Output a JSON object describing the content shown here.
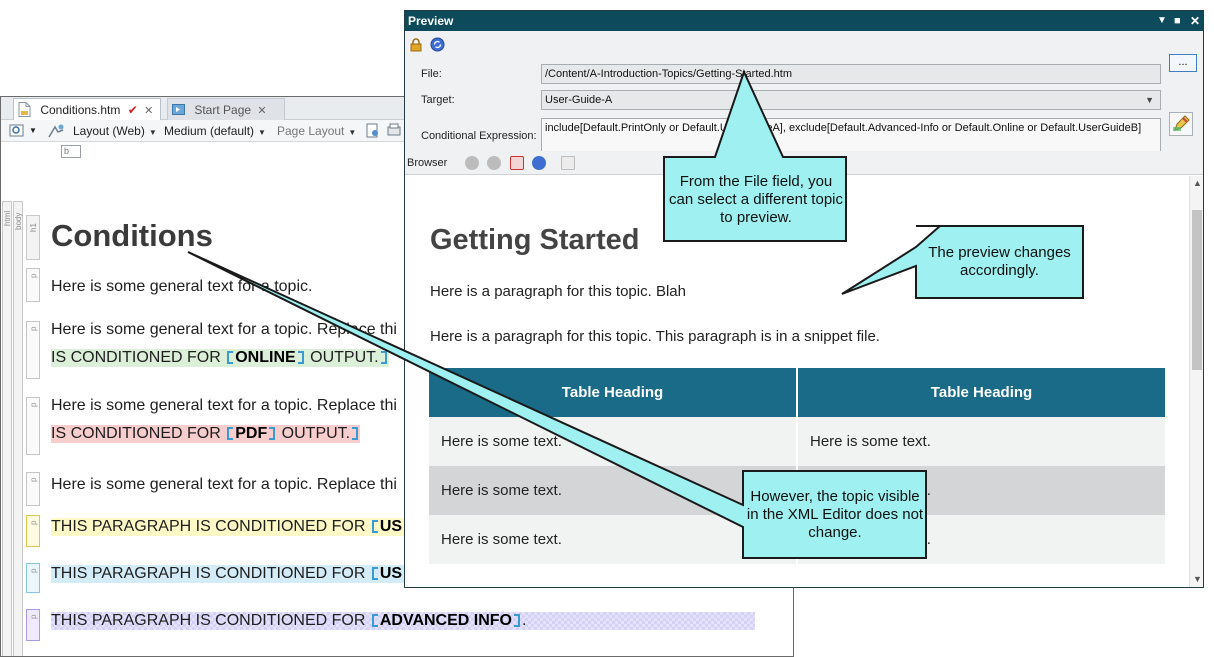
{
  "editor": {
    "tabs": [
      {
        "label": "Conditions.htm",
        "modified": "✔",
        "close": "✕"
      },
      {
        "label": "Start Page",
        "close": "✕"
      }
    ],
    "toolbar": {
      "layout": "Layout (Web)",
      "medium": "Medium (default)",
      "page_layout": "Page Layout"
    },
    "chip": "b",
    "structure_labels": [
      "html",
      "body",
      "h1"
    ],
    "p_label": "p",
    "heading": "Conditions",
    "paragraphs": [
      {
        "text": "Here is some general text for a topic."
      },
      {
        "line1": "Here is some general text for a topic. Replace thi",
        "prefix": "IS CONDITIONED FOR ",
        "keyword": "ONLINE",
        "suffix": " OUTPUT."
      },
      {
        "line1": "Here is some general text for a topic. Replace thi",
        "prefix": "IS CONDITIONED FOR ",
        "keyword": "PDF",
        "suffix": " OUTPUT."
      },
      {
        "text": "Here is some general text for a topic. Replace thi"
      },
      {
        "prefix": "THIS PARAGRAPH IS CONDITIONED FOR ",
        "keyword": "US"
      },
      {
        "prefix": "THIS PARAGRAPH IS CONDITIONED FOR ",
        "keyword": "US"
      },
      {
        "prefix": "THIS PARAGRAPH IS CONDITIONED FOR ",
        "keyword": "ADVANCED INFO",
        "suffix": "."
      }
    ]
  },
  "preview": {
    "title": "Preview",
    "file_label": "File:",
    "file_value": "/Content/A-Introduction-Topics/Getting-Started.htm",
    "browse_label": "...",
    "target_label": "Target:",
    "target_value": "User-Guide-A",
    "cond_label": "Conditional Expression:",
    "cond_value": "include[Default.PrintOnly or Default.UserGuideA], exclude[Default.Advanced-Info or Default.Online or Default.UserGuideB]",
    "browser_label": "Browser",
    "page": {
      "heading": "Getting Started",
      "p1": "Here is a paragraph for this topic. Blah",
      "p2": "Here is a paragraph for this topic. This paragraph is in a snippet file.",
      "table_headers": [
        "Table Heading",
        "Table Heading"
      ],
      "table_rows": [
        [
          "Here is some text.",
          "Here is some text."
        ],
        [
          "Here is some text.",
          "Here is some text."
        ],
        [
          "Here is some text.",
          "Here is some text."
        ]
      ]
    }
  },
  "callouts": {
    "file": "From the File field, you can select a different topic to preview.",
    "preview": "The preview changes accordingly.",
    "editor": "However, the topic visible in the XML Editor does not change."
  },
  "colors": {
    "callout_fill": "#9ff0f0",
    "callout_stroke": "#1a1a1a",
    "preview_title": "#0d4b5c",
    "table_header": "#1a6b88"
  }
}
